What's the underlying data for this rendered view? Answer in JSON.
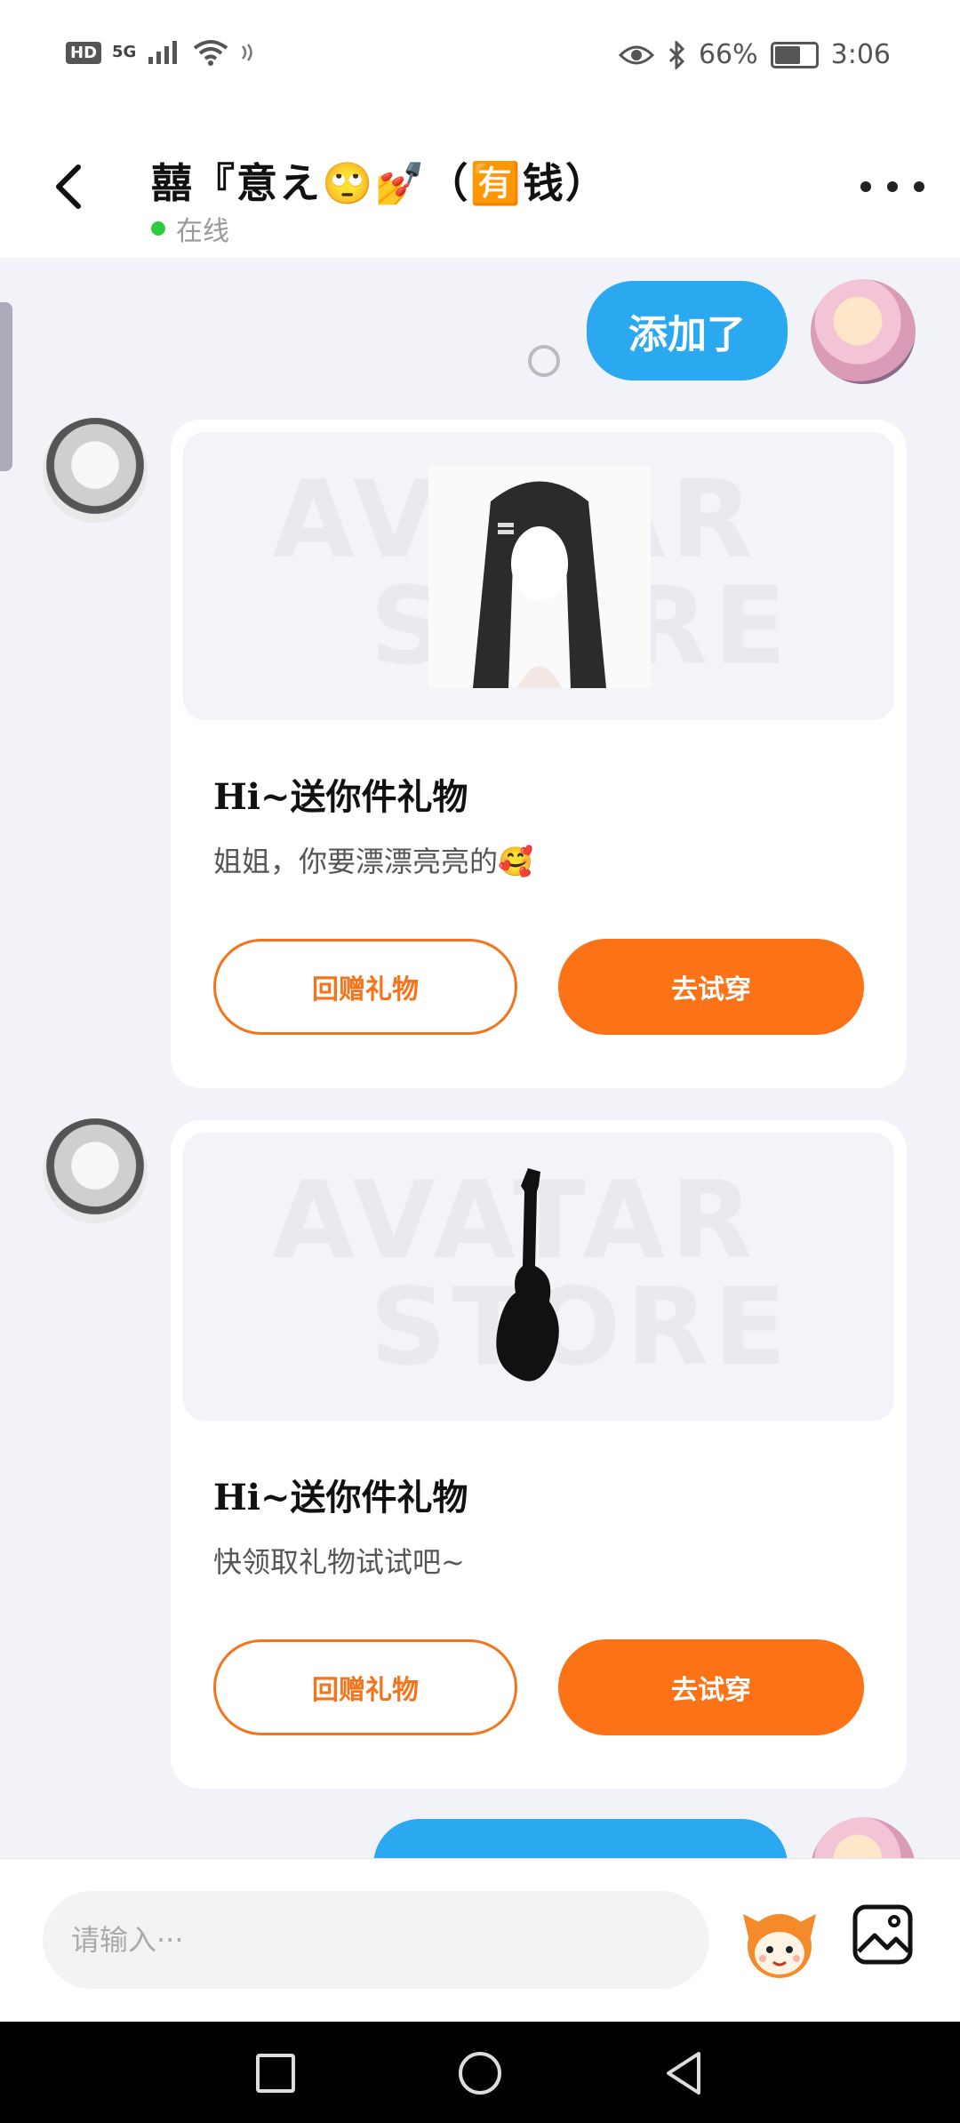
{
  "status_bar": {
    "hd": "HD",
    "network": "5G",
    "battery_text": "66%",
    "battery_level": 0.66,
    "time": "3:06"
  },
  "header": {
    "title": "囍『意え🙄💅（🈶钱）",
    "status": "在线"
  },
  "messages": {
    "self_text": "添加了"
  },
  "gift_cards": [
    {
      "title": "Hi~送你件礼物",
      "subtitle": "姐姐，你要漂漂亮亮的🥰",
      "watermark_top": "AVATAR",
      "watermark_bottom": "STORE",
      "return_gift_label": "回赠礼物",
      "try_on_label": "去试穿"
    },
    {
      "title": "Hi~送你件礼物",
      "subtitle": "快领取礼物试试吧~",
      "watermark_top": "AVATAR",
      "watermark_bottom": "STORE",
      "return_gift_label": "回赠礼物",
      "try_on_label": "去试穿"
    }
  ],
  "input": {
    "placeholder": "请输入···"
  },
  "colors": {
    "accent_orange": "#fb7217",
    "bubble_blue": "#2aa9f1",
    "online_green": "#2ecc40"
  },
  "icons": {
    "back": "chevron-left-icon",
    "more": "more-dots-icon",
    "emoji": "mascot-emoji-icon",
    "image": "image-icon"
  }
}
